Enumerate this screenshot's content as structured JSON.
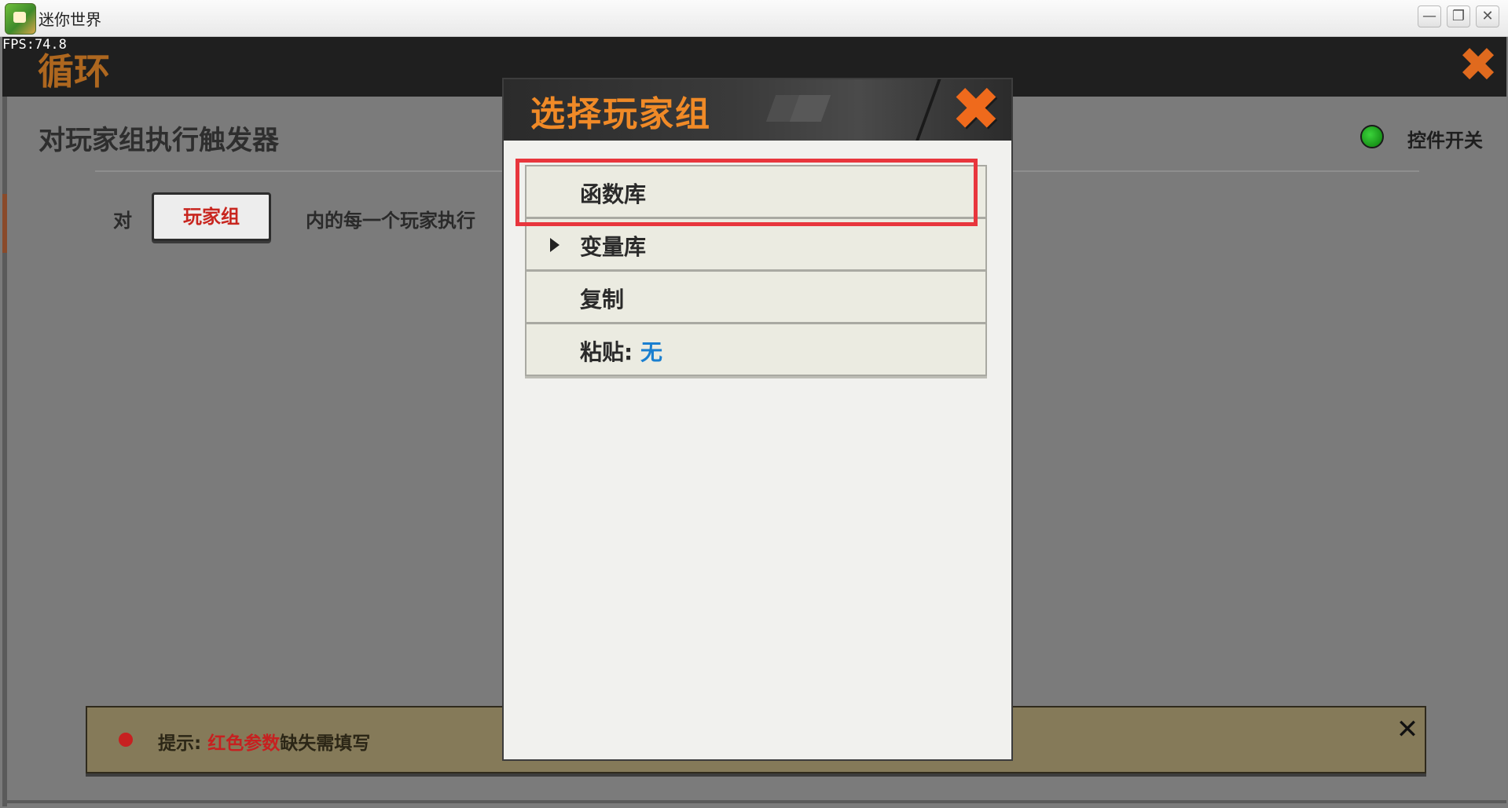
{
  "window": {
    "title": "迷你世界",
    "minimize_glyph": "—",
    "maximize_glyph": "❐",
    "close_glyph": "✕"
  },
  "game": {
    "fps": "FPS:74.8",
    "header_title": "循环",
    "close_glyph": "✖"
  },
  "editor": {
    "section_title": "对玩家组执行触发器",
    "control_switch_label": "控件开关",
    "control_switch_color": "#1aa51a",
    "row_prefix": "对",
    "group_button_label": "玩家组",
    "row_suffix": "内的每一个玩家执行"
  },
  "hint": {
    "prefix": "提示: ",
    "highlight": "红色参数",
    "suffix": "缺失需填写",
    "close_glyph": "✕"
  },
  "modal": {
    "title": "选择玩家组",
    "close_glyph": "✖",
    "items": [
      {
        "label": "函数库"
      },
      {
        "label": "变量库",
        "has_submenu": true
      },
      {
        "label": "复制"
      },
      {
        "label": "粘贴: ",
        "value": "无"
      }
    ]
  },
  "colors": {
    "accent_orange": "#f08a27",
    "error_red": "#c72020",
    "highlight_red": "#e8363d",
    "link_blue": "#1a7fd0"
  }
}
